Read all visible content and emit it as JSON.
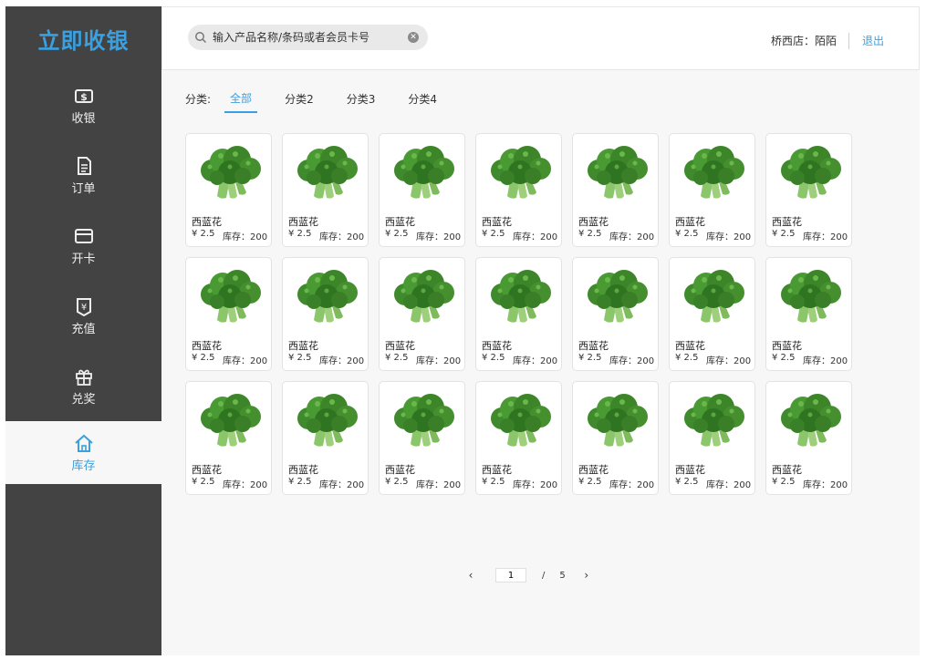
{
  "sidebar": {
    "brand": "立即收银",
    "items": [
      {
        "label": "收银",
        "icon": "dollar-icon"
      },
      {
        "label": "订单",
        "icon": "document-icon"
      },
      {
        "label": "开卡",
        "icon": "card-icon"
      },
      {
        "label": "充值",
        "icon": "recharge-icon"
      },
      {
        "label": "兑奖",
        "icon": "gift-icon"
      },
      {
        "label": "库存",
        "icon": "home-icon",
        "active": true
      }
    ]
  },
  "header": {
    "search_placeholder": "输入产品名称/条码或者会员卡号",
    "store": "桥西店：陌陌",
    "logout": "退出"
  },
  "categories": {
    "label": "分类:",
    "tabs": [
      "全部",
      "分类2",
      "分类3",
      "分类4"
    ],
    "active_index": 0
  },
  "products": [
    {
      "name": "西蓝花",
      "price": "¥ 2.5",
      "stock": "库存：200"
    },
    {
      "name": "西蓝花",
      "price": "¥ 2.5",
      "stock": "库存：200"
    },
    {
      "name": "西蓝花",
      "price": "¥ 2.5",
      "stock": "库存：200"
    },
    {
      "name": "西蓝花",
      "price": "¥ 2.5",
      "stock": "库存：200"
    },
    {
      "name": "西蓝花",
      "price": "¥ 2.5",
      "stock": "库存：200"
    },
    {
      "name": "西蓝花",
      "price": "¥ 2.5",
      "stock": "库存：200"
    },
    {
      "name": "西蓝花",
      "price": "¥ 2.5",
      "stock": "库存：200"
    },
    {
      "name": "西蓝花",
      "price": "¥ 2.5",
      "stock": "库存：200"
    },
    {
      "name": "西蓝花",
      "price": "¥ 2.5",
      "stock": "库存：200"
    },
    {
      "name": "西蓝花",
      "price": "¥ 2.5",
      "stock": "库存：200"
    },
    {
      "name": "西蓝花",
      "price": "¥ 2.5",
      "stock": "库存：200"
    },
    {
      "name": "西蓝花",
      "price": "¥ 2.5",
      "stock": "库存：200"
    },
    {
      "name": "西蓝花",
      "price": "¥ 2.5",
      "stock": "库存：200"
    },
    {
      "name": "西蓝花",
      "price": "¥ 2.5",
      "stock": "库存：200"
    },
    {
      "name": "西蓝花",
      "price": "¥ 2.5",
      "stock": "库存：200"
    },
    {
      "name": "西蓝花",
      "price": "¥ 2.5",
      "stock": "库存：200"
    },
    {
      "name": "西蓝花",
      "price": "¥ 2.5",
      "stock": "库存：200"
    },
    {
      "name": "西蓝花",
      "price": "¥ 2.5",
      "stock": "库存：200"
    },
    {
      "name": "西蓝花",
      "price": "¥ 2.5",
      "stock": "库存：200"
    },
    {
      "name": "西蓝花",
      "price": "¥ 2.5",
      "stock": "库存：200"
    },
    {
      "name": "西蓝花",
      "price": "¥ 2.5",
      "stock": "库存：200"
    }
  ],
  "pagination": {
    "current": "1",
    "separator": "/",
    "total": "5"
  },
  "colors": {
    "accent": "#3aa0e0",
    "sidebar_bg": "#434343",
    "content_bg": "#f7f7f7"
  }
}
